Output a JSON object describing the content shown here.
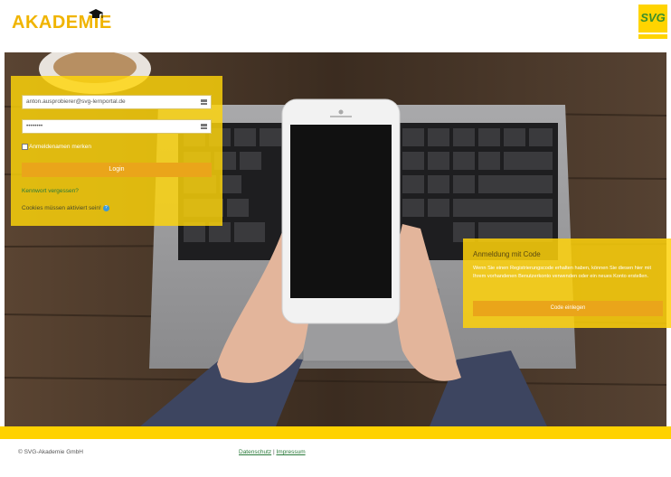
{
  "header": {
    "logo_text": "AKADEMIE",
    "brand_logo_text": "SVG"
  },
  "login": {
    "username_value": "anton.ausprobierer@svg-lernportal.de",
    "password_value": "••••••••",
    "remember_label": "Anmeldenamen merken",
    "login_button": "Login",
    "forgot_link": "Kennwort vergessen?",
    "cookies_note": "Cookies müssen aktiviert sein!"
  },
  "code_panel": {
    "title": "Anmeldung mit Code",
    "text": "Wenn Sie einen Registrierungscode erhalten haben, können Sie diesen hier mit Ihrem vorhandenen Benutzerkonto verwenden oder ein neues Konto erstellen.",
    "button": "Code einlegen"
  },
  "footer": {
    "copyright": "© SVG-Akademie GmbH",
    "privacy_link": "Datenschutz",
    "separator": "|",
    "imprint_link": "Impressum"
  },
  "colors": {
    "accent_yellow": "#ffd200",
    "button_orange": "#eaa51a",
    "link_green": "#2a7a3a"
  },
  "icons": {
    "logo_cap": "graduation-cap-icon",
    "field_icon": "keypad-icon",
    "help": "help-icon"
  }
}
